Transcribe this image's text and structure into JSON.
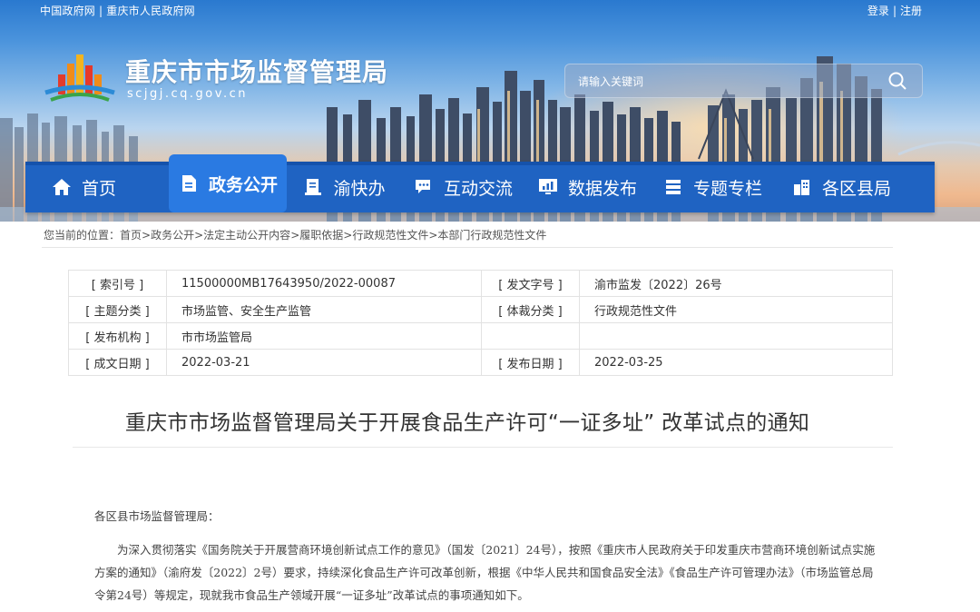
{
  "header": {
    "top_links": [
      "中国政府网",
      "重庆市人民政府网"
    ],
    "user_links": [
      "登录",
      "注册"
    ],
    "site_title": "重庆市市场监督管理局",
    "site_domain": "scjgj.cq.gov.cn",
    "search_placeholder": "请输入关键词"
  },
  "nav": [
    {
      "label": "首页",
      "icon": "home-icon",
      "active": false
    },
    {
      "label": "政务公开",
      "icon": "document-icon",
      "active": true
    },
    {
      "label": "渝快办",
      "icon": "service-icon",
      "active": false
    },
    {
      "label": "互动交流",
      "icon": "chat-icon",
      "active": false
    },
    {
      "label": "数据发布",
      "icon": "monitor-chart-icon",
      "active": false
    },
    {
      "label": "专题专栏",
      "icon": "list-icon",
      "active": false
    },
    {
      "label": "各区县局",
      "icon": "buildings-icon",
      "active": false
    }
  ],
  "breadcrumb": {
    "prefix": "您当前的位置：",
    "items": [
      "首页",
      "政务公开",
      "法定主动公开内容",
      "履职依据",
      "行政规范性文件",
      "本部门行政规范性文件"
    ]
  },
  "meta": {
    "index_label": "[ 索引号 ]",
    "index_value": "11500000MB17643950/2022-00087",
    "docno_label": "[ 发文字号 ]",
    "docno_value": "渝市监发〔2022〕26号",
    "topic_label": "[ 主题分类 ]",
    "topic_value": "市场监管、安全生产监管",
    "genre_label": "[ 体裁分类 ]",
    "genre_value": "行政规范性文件",
    "org_label": "[ 发布机构 ]",
    "org_value": "市市场监管局",
    "created_label": "[ 成文日期 ]",
    "created_value": "2022-03-21",
    "published_label": "[ 发布日期 ]",
    "published_value": "2022-03-25"
  },
  "article": {
    "title": "重庆市市场监督管理局关于开展食品生产许可“一证多址” 改革试点的通知",
    "salutation": "各区县市场监督管理局：",
    "paragraph1": "为深入贯彻落实《国务院关于开展营商环境创新试点工作的意见》（国发〔2021〕24号），按照《重庆市人民政府关于印发重庆市营商环境创新试点实施方案的通知》（渝府发〔2022〕2号）要求，持续深化食品生产许可改革创新，根据《中华人民共和国食品安全法》《食品生产许可管理办法》（市场监管总局令第24号）等规定，现就我市食品生产领域开展“一证多址”改革试点的事项通知如下。"
  },
  "colors": {
    "nav_bg": "#1f63c2",
    "nav_active": "#2a7ae2",
    "text": "#333333"
  }
}
